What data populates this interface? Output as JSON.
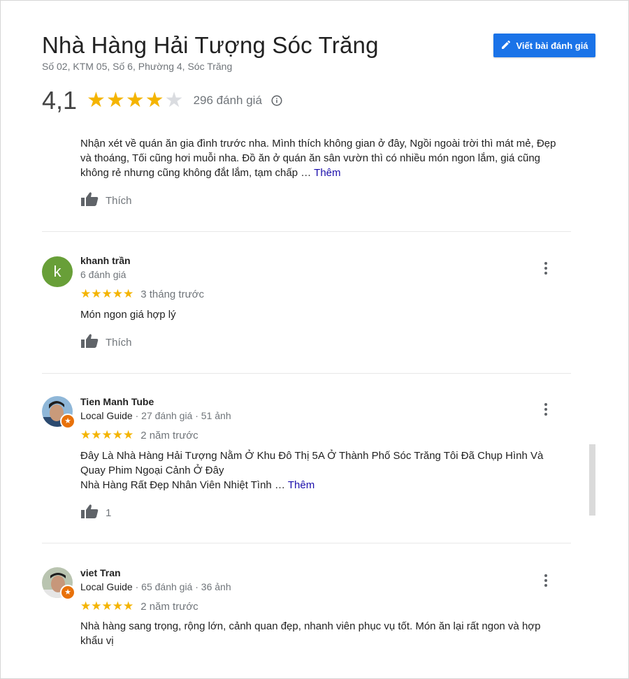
{
  "header": {
    "title": "Nhà Hàng Hải Tượng Sóc Trăng",
    "address": "Số 02, KTM 05, Số 6, Phường 4, Sóc Trăng",
    "write_review_label": "Viết bài đánh giá"
  },
  "summary": {
    "rating": "4,1",
    "rating_value": 4.1,
    "stars_filled": 4,
    "stars_total": 5,
    "review_count": "296 đánh giá"
  },
  "colors": {
    "accent": "#1a73e8",
    "star": "#f4b400",
    "link": "#1a0dab",
    "local_guide_badge": "#e8710a"
  },
  "icons": [
    "pencil-icon",
    "star-icon",
    "info-icon",
    "thumbs-up-icon",
    "more-vert-icon",
    "local-guide-badge-icon"
  ],
  "top_review": {
    "text_lines": [
      "Nhận xét về quán ăn gia đình trước nha. Mình thích không gian ở đây, Ngồi ngoài trời thì mát mẻ, Đẹp",
      "và thoáng, Tối cũng hơi muỗi nha. Đồ ăn ở quán ăn sân vườn thì có nhiều món ngon lắm, giá cũng",
      "không rẻ nhưng cũng không đắt lắm, tạm chấp …"
    ],
    "more_label": "Thêm",
    "like_label": "Thích"
  },
  "reviews": [
    {
      "name": "khanh trần",
      "avatar_letter": "k",
      "meta": "6 đánh giá",
      "stars": 5,
      "time": "3 tháng trước",
      "text_lines": [
        "Món ngon giá hợp lý"
      ],
      "like_label": "Thích"
    },
    {
      "name": "Tien Manh Tube",
      "guide_label": "Local Guide",
      "meta": " · 27 đánh giá · 51 ảnh",
      "stars": 5,
      "time": "2 năm trước",
      "text_lines": [
        "Đây Là Nhà Hàng Hải Tượng Nằm Ở Khu Đô Thị 5A Ở Thành Phố Sóc Trăng Tôi Đã Chụp Hình Và",
        "Quay Phim Ngoại Cảnh Ở Đây",
        "Nhà Hàng Rất Đẹp Nhân Viên Nhiệt Tình …"
      ],
      "more_label": "Thêm",
      "like_count": "1"
    },
    {
      "name": "viet Tran",
      "guide_label": "Local Guide",
      "meta": " · 65 đánh giá · 36 ảnh",
      "stars": 5,
      "time": "2 năm trước",
      "text_lines": [
        "Nhà hàng sang trọng, rộng lớn, cảnh quan đẹp, nhanh viên phục vụ tốt. Món ăn lại rất ngon và hợp",
        "khẩu vị"
      ]
    }
  ]
}
